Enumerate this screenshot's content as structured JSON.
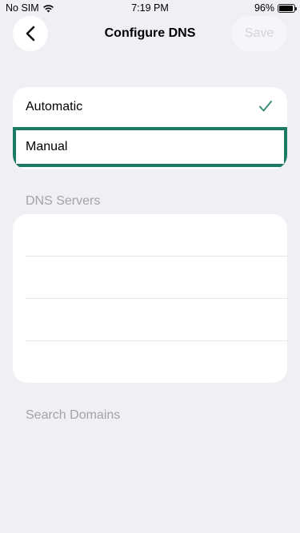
{
  "status_bar": {
    "carrier": "No SIM",
    "time": "7:19 PM",
    "battery_percent": "96%",
    "battery_level": 0.96
  },
  "nav": {
    "title": "Configure DNS",
    "save_label": "Save",
    "back_icon": "chevron-left-icon"
  },
  "mode": {
    "options": [
      {
        "label": "Automatic",
        "selected": true
      },
      {
        "label": "Manual",
        "selected": false
      }
    ],
    "check_color": "#3b8f7c",
    "highlight_color": "#1a7a63"
  },
  "dns_servers": {
    "header": "DNS Servers",
    "entries": [
      "",
      "",
      "",
      ""
    ]
  },
  "search_domains": {
    "header": "Search Domains"
  }
}
